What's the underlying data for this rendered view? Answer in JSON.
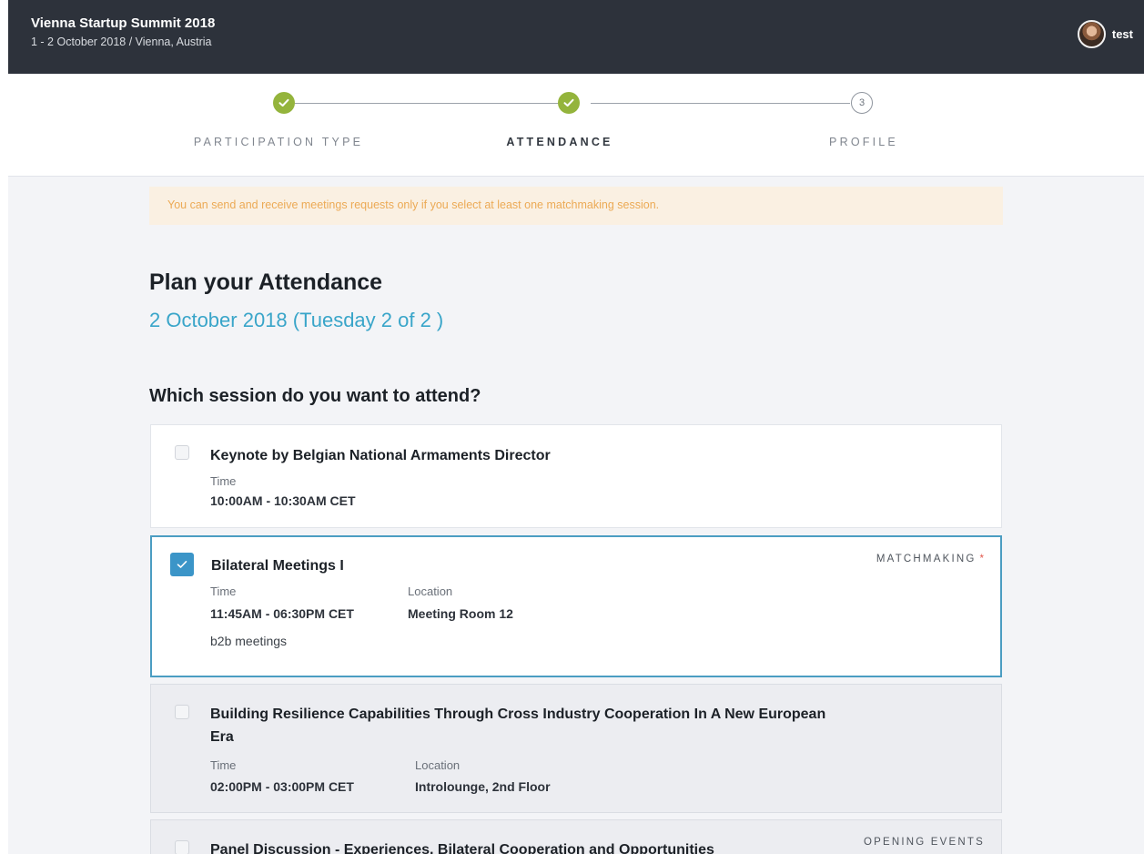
{
  "event": {
    "title": "Vienna Startup Summit 2018",
    "subtitle": "1 - 2 October 2018 / Vienna, Austria"
  },
  "user": {
    "name": "test"
  },
  "steps": [
    {
      "label": "PARTICIPATION TYPE",
      "state": "done"
    },
    {
      "label": "ATTENDANCE",
      "state": "done"
    },
    {
      "label": "PROFILE",
      "state": "todo",
      "number": "3"
    }
  ],
  "alert": {
    "text": "You can send and receive meetings requests only if you select at least one matchmaking session."
  },
  "page": {
    "title": "Plan your Attendance",
    "date": "2 October 2018 (Tuesday 2 of 2 )",
    "question": "Which session do you want to attend?"
  },
  "labels": {
    "time": "Time",
    "location": "Location"
  },
  "sessions": [
    {
      "title": "Keynote by Belgian National Armaments Director",
      "time": "10:00AM - 10:30AM CET",
      "selected": false
    },
    {
      "title": "Bilateral Meetings I",
      "time": "11:45AM - 06:30PM CET",
      "location": "Meeting Room 12",
      "description": "b2b meetings",
      "tag": "MATCHMAKING",
      "required_marker": "*",
      "selected": true
    },
    {
      "title": "Building Resilience Capabilities Through Cross Industry Cooperation In A New European Era",
      "time": "02:00PM - 03:00PM CET",
      "location": "Introlounge, 2nd Floor",
      "selected": false
    },
    {
      "title": "Panel Discussion - Experiences, Bilateral Cooperation and Opportunities",
      "tag": "OPENING EVENTS",
      "selected": false
    }
  ],
  "colors": {
    "topbar": "#2d323b",
    "step_done": "#94b43c",
    "accent_blue": "#39a5c9",
    "checkbox_checked": "#3b95c8",
    "alert_bg": "#faf0e2",
    "alert_text": "#ecaa55",
    "required_star": "#e2574c"
  }
}
